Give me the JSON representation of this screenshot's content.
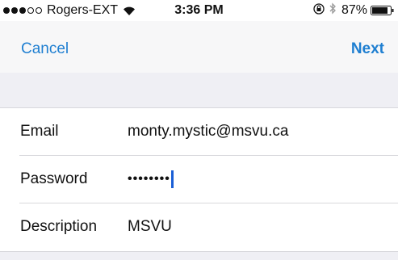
{
  "status_bar": {
    "signal_bars_filled": 3,
    "signal_bars_total": 5,
    "carrier": "Rogers-EXT",
    "time": "3:36 PM",
    "battery_percent": "87%",
    "icons": [
      "wifi-icon",
      "rotation-lock-icon",
      "bluetooth-icon",
      "battery-icon"
    ]
  },
  "nav": {
    "cancel_label": "Cancel",
    "next_label": "Next",
    "accent_color": "#1f7fd1"
  },
  "form": {
    "email_label": "Email",
    "email_value": "monty.mystic@msvu.ca",
    "password_label": "Password",
    "password_value": "••••••••",
    "description_label": "Description",
    "description_value": "MSVU"
  }
}
